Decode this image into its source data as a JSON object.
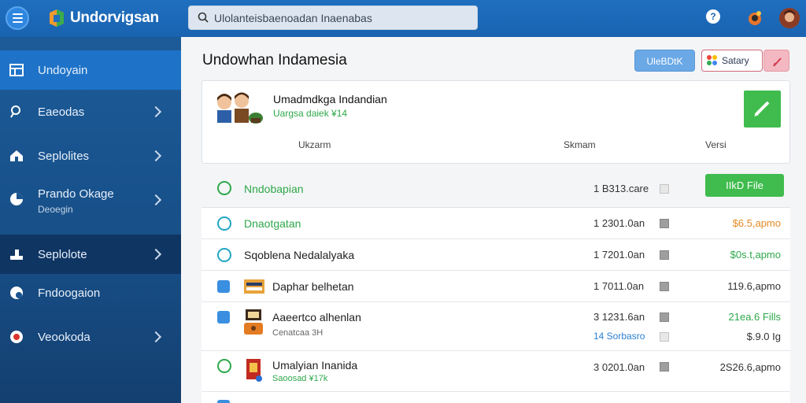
{
  "app": {
    "title": "Undorvigsan",
    "search_placeholder": "Ulolanteisbaenoadan Inaenabas"
  },
  "sidebar": {
    "items": [
      {
        "label": "Undoyain",
        "icon": "table-icon",
        "active": true
      },
      {
        "label": "Eaeodas",
        "icon": "search-icon"
      },
      {
        "label": "Seplolites",
        "icon": "house-icon"
      },
      {
        "label": "Prando Okage",
        "sublabel": "Deoegin",
        "icon": "chart-icon"
      },
      {
        "label": "Seplolote",
        "icon": "hand-icon",
        "dark": true
      },
      {
        "label": "Fndoogaion",
        "icon": "globe-icon"
      },
      {
        "label": "Veookoda",
        "icon": "badge-icon"
      }
    ]
  },
  "main": {
    "title": "Undowhan Indamesia",
    "buttons": {
      "primary": "UleBDtK",
      "gallery": "Satary"
    },
    "card": {
      "title": "Umadmdkga Indandian",
      "subtitle": "Uargsa daiek  ¥14",
      "columns": [
        "Ukzarm",
        "Skmam",
        "Versi"
      ]
    },
    "file_button": "IIkD File",
    "rows": [
      {
        "name": "Nndobapian",
        "date": "1 B313.care",
        "size": "",
        "check": "green"
      },
      {
        "name": "Dnaotgatan",
        "date": "1 2301.0an",
        "size": "$6.5,apmo",
        "size_color": "orange"
      },
      {
        "name": "Sqoblena Nedalalyaka",
        "date": "1 7201.0an",
        "size": "$0s.t,apmo",
        "size_color": "green"
      },
      {
        "name": "Daphar belhetan",
        "date": "1 7011.0an",
        "size": "119.6,apmo",
        "size_color": "grey"
      },
      {
        "name": "Aaeertco alhenlan",
        "sub": "Cenatcaa  3H",
        "date": "3 1231.6an",
        "date2": "14  Sorbasro",
        "size": "21ea.6 Fills",
        "size2": "$.9.0 Ig",
        "size_color": "green"
      },
      {
        "name": "Umalyian Inanida",
        "sub": "Saoosad  ¥17k",
        "date": "3 0201.0an",
        "size": "2S26.6,apmo",
        "size_color": "grey"
      }
    ]
  }
}
